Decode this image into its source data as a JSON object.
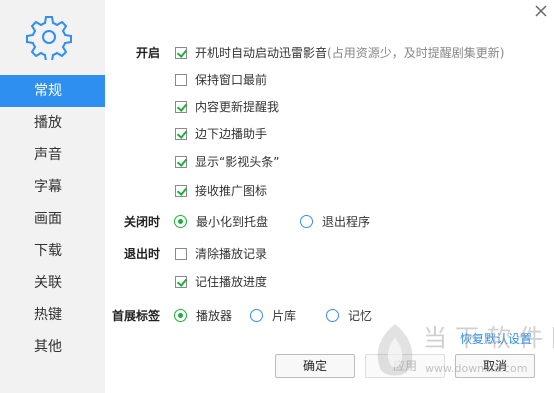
{
  "sidebar": {
    "items": [
      {
        "label": "常规",
        "active": true
      },
      {
        "label": "播放",
        "active": false
      },
      {
        "label": "声音",
        "active": false
      },
      {
        "label": "字幕",
        "active": false
      },
      {
        "label": "画面",
        "active": false
      },
      {
        "label": "下载",
        "active": false
      },
      {
        "label": "关联",
        "active": false
      },
      {
        "label": "热键",
        "active": false
      },
      {
        "label": "其他",
        "active": false
      }
    ]
  },
  "settings": {
    "startup": {
      "label": "开启",
      "options": [
        {
          "text": "开机时自动启动迅雷影音",
          "hint": "(占用资源少，及时提醒剧集更新)",
          "checked": true
        },
        {
          "text": "保持窗口最前",
          "checked": false
        },
        {
          "text": "内容更新提醒我",
          "checked": true
        },
        {
          "text": "边下边播助手",
          "checked": true
        },
        {
          "text": "显示“影视头条”",
          "checked": true
        },
        {
          "text": "接收推广图标",
          "checked": true
        }
      ]
    },
    "on_close": {
      "label": "关闭时",
      "options": [
        {
          "text": "最小化到托盘",
          "checked": true
        },
        {
          "text": "退出程序",
          "checked": false
        }
      ]
    },
    "on_exit": {
      "label": "退出时",
      "options": [
        {
          "text": "清除播放记录",
          "checked": false
        },
        {
          "text": "记住播放进度",
          "checked": true
        }
      ]
    },
    "first_tab": {
      "label": "首展标签",
      "options": [
        {
          "text": "播放器",
          "checked": true
        },
        {
          "text": "片库",
          "checked": false
        },
        {
          "text": "记忆",
          "checked": false
        }
      ]
    }
  },
  "footer": {
    "restore_defaults": "恢复默认设置",
    "ok": "确定",
    "apply": "应用",
    "cancel": "取消"
  },
  "watermark": {
    "title": "当下软件园",
    "subtitle": "www.downxia.com"
  },
  "colors": {
    "accent": "#2f8ff0",
    "check": "#1fae3a",
    "sidebar_bg": "#f2f2f2"
  }
}
